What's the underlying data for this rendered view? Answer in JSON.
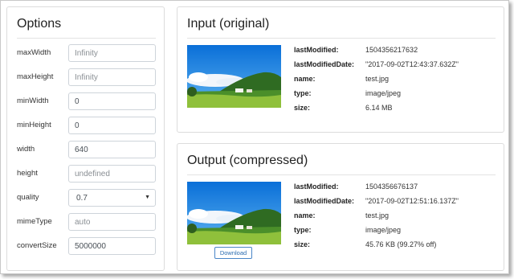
{
  "options": {
    "title": "Options",
    "fields": [
      {
        "label": "maxWidth",
        "value": "",
        "placeholder": "Infinity",
        "type": "input"
      },
      {
        "label": "maxHeight",
        "value": "",
        "placeholder": "Infinity",
        "type": "input"
      },
      {
        "label": "minWidth",
        "value": "0",
        "placeholder": "",
        "type": "input"
      },
      {
        "label": "minHeight",
        "value": "0",
        "placeholder": "",
        "type": "input"
      },
      {
        "label": "width",
        "value": "640",
        "placeholder": "",
        "type": "input"
      },
      {
        "label": "height",
        "value": "",
        "placeholder": "undefined",
        "type": "input"
      },
      {
        "label": "quality",
        "value": "0.7",
        "placeholder": "",
        "type": "select"
      },
      {
        "label": "mimeType",
        "value": "",
        "placeholder": "auto",
        "type": "input"
      },
      {
        "label": "convertSize",
        "value": "5000000",
        "placeholder": "",
        "type": "input"
      }
    ]
  },
  "input": {
    "title": "Input (original)",
    "meta": [
      {
        "key": "lastModified:",
        "value": "1504356217632"
      },
      {
        "key": "lastModifiedDate:",
        "value": "\"2017-09-02T12:43:37.632Z\""
      },
      {
        "key": "name:",
        "value": "test.jpg"
      },
      {
        "key": "type:",
        "value": "image/jpeg"
      },
      {
        "key": "size:",
        "value": "6.14 MB"
      }
    ]
  },
  "output": {
    "title": "Output (compressed)",
    "download_label": "Download",
    "meta": [
      {
        "key": "lastModified:",
        "value": "1504356676137"
      },
      {
        "key": "lastModifiedDate:",
        "value": "\"2017-09-02T12:51:16.137Z\""
      },
      {
        "key": "name:",
        "value": "test.jpg"
      },
      {
        "key": "type:",
        "value": "image/jpeg"
      },
      {
        "key": "size:",
        "value": "45.76 KB (99.27% off)"
      }
    ]
  },
  "icons": {
    "select_caret": "chevron-down-icon",
    "thumbnail": "landscape-image"
  }
}
